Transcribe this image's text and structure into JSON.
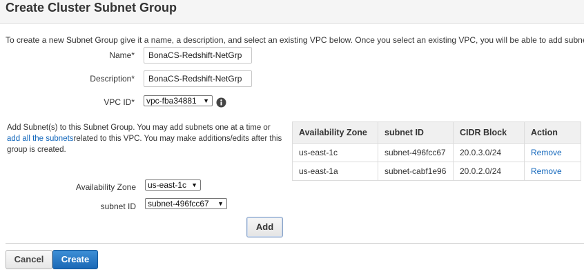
{
  "title": "Create Cluster Subnet Group",
  "intro": "To create a new Subnet Group give it a name, a description, and select an existing VPC below. Once you select an existing VPC, you will be able to add subnets r",
  "form": {
    "name_label": "Name*",
    "name_value": "BonaCS-Redshift-NetGrp",
    "description_label": "Description*",
    "description_value": "BonaCS-Redshift-NetGrp",
    "vpc_label": "VPC ID*",
    "vpc_value": "vpc-fba34881"
  },
  "subnet_help": {
    "text_before": "Add Subnet(s) to this Subnet Group. You may add subnets one at a time or ",
    "link": "add all the subnets",
    "text_after": "related to this VPC. You may make additions/edits after this group is created."
  },
  "subnet_select": {
    "az_label": "Availability Zone",
    "az_value": "us-east-1c",
    "subnet_label": "subnet ID",
    "subnet_value": "subnet-496fcc67"
  },
  "table": {
    "headers": [
      "Availability Zone",
      "subnet ID",
      "CIDR Block",
      "Action"
    ],
    "rows": [
      {
        "az": "us-east-1c",
        "subnet": "subnet-496fcc67",
        "cidr": "20.0.3.0/24",
        "action": "Remove"
      },
      {
        "az": "us-east-1a",
        "subnet": "subnet-cabf1e96",
        "cidr": "20.0.2.0/24",
        "action": "Remove"
      }
    ]
  },
  "buttons": {
    "add": "Add",
    "cancel": "Cancel",
    "create": "Create"
  },
  "colors": {
    "link": "#1166bb",
    "primary": "#1a68b6"
  }
}
